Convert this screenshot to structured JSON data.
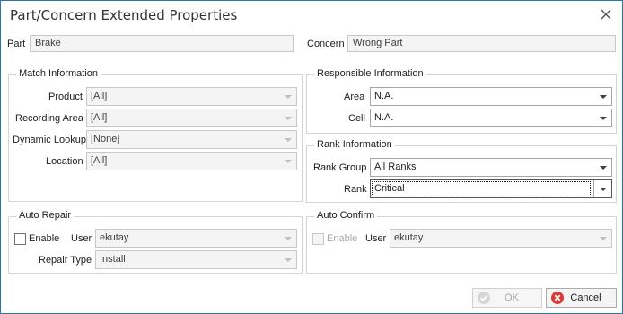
{
  "window": {
    "title": "Part/Concern Extended Properties"
  },
  "part": {
    "label": "Part",
    "value": "Brake"
  },
  "concern": {
    "label": "Concern",
    "value": "Wrong Part"
  },
  "match": {
    "title": "Match Information",
    "product": {
      "label": "Product",
      "value": "[All]"
    },
    "recording_area": {
      "label": "Recording Area",
      "value": "[All]"
    },
    "dynamic_lookup": {
      "label": "Dynamic Lookup",
      "value": "[None]"
    },
    "location": {
      "label": "Location",
      "value": "[All]"
    }
  },
  "responsible": {
    "title": "Responsible Information",
    "area": {
      "label": "Area",
      "value": "N.A."
    },
    "cell": {
      "label": "Cell",
      "value": "N.A."
    }
  },
  "rank": {
    "title": "Rank Information",
    "group": {
      "label": "Rank Group",
      "value": "All Ranks"
    },
    "rank": {
      "label": "Rank",
      "value": "Critical"
    }
  },
  "auto_repair": {
    "title": "Auto Repair",
    "enable_label": "Enable",
    "user_label": "User",
    "user_value": "ekutay",
    "repair_type_label": "Repair Type",
    "repair_type_value": "Install"
  },
  "auto_confirm": {
    "title": "Auto Confirm",
    "enable_label": "Enable",
    "user_label": "User",
    "user_value": "ekutay"
  },
  "buttons": {
    "ok": "OK",
    "cancel": "Cancel"
  },
  "colors": {
    "border_accent": "#2b77b4",
    "cancel_icon": "#d83b3b"
  }
}
